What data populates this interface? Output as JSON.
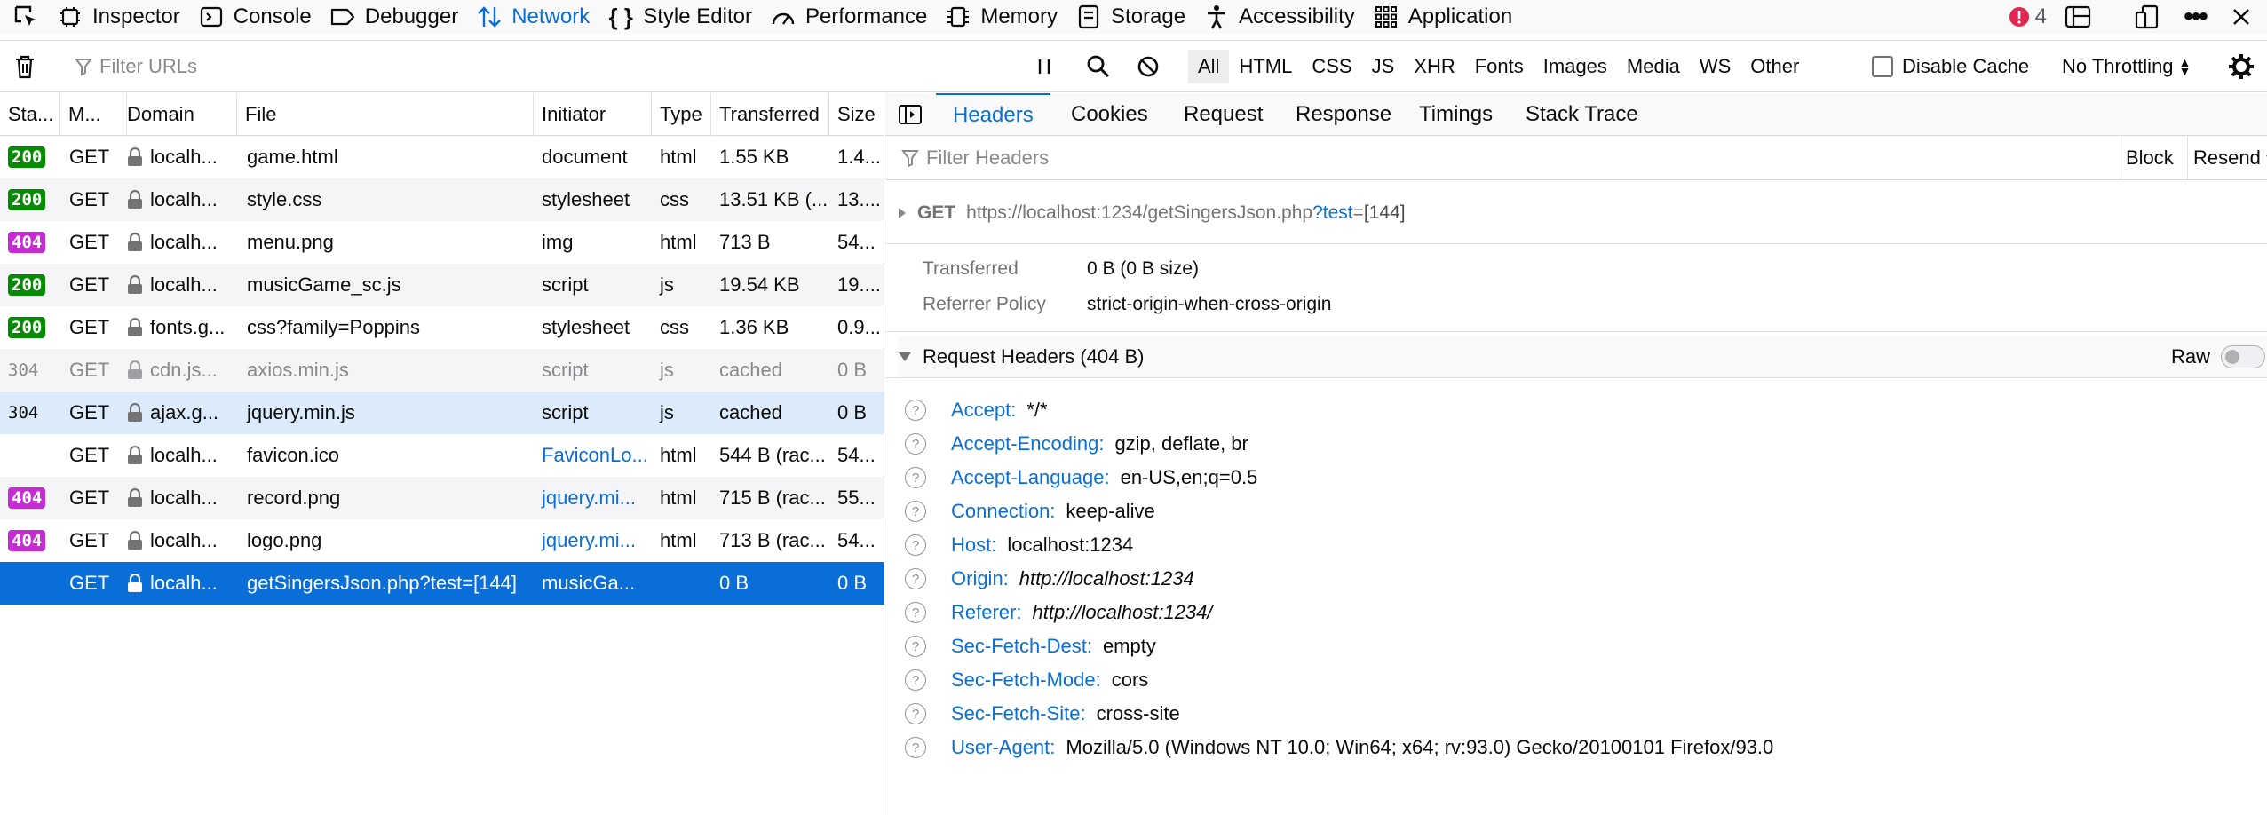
{
  "toolbar": {
    "tabs": [
      {
        "label": "Inspector",
        "icon": "inspector-icon"
      },
      {
        "label": "Console",
        "icon": "console-icon"
      },
      {
        "label": "Debugger",
        "icon": "debugger-icon"
      },
      {
        "label": "Network",
        "icon": "network-icon",
        "active": true
      },
      {
        "label": "Style Editor",
        "icon": "style-editor-icon"
      },
      {
        "label": "Performance",
        "icon": "performance-icon"
      },
      {
        "label": "Memory",
        "icon": "memory-icon"
      },
      {
        "label": "Storage",
        "icon": "storage-icon"
      },
      {
        "label": "Accessibility",
        "icon": "accessibility-icon"
      },
      {
        "label": "Application",
        "icon": "application-icon"
      }
    ],
    "error_count": "4"
  },
  "filterbar": {
    "filter_placeholder": "Filter URLs",
    "types": [
      "All",
      "HTML",
      "CSS",
      "JS",
      "XHR",
      "Fonts",
      "Images",
      "Media",
      "WS",
      "Other"
    ],
    "selected_type": "All",
    "disable_cache_label": "Disable Cache",
    "throttling": "No Throttling"
  },
  "table": {
    "columns": [
      "Sta...",
      "M...",
      "Domain",
      "File",
      "Initiator",
      "Type",
      "Transferred",
      "Size"
    ],
    "rows": [
      {
        "status": "200",
        "method": "GET",
        "domain": "localh...",
        "file": "game.html",
        "initiator": "document",
        "type": "html",
        "transferred": "1.55 KB",
        "size": "1.4..."
      },
      {
        "status": "200",
        "method": "GET",
        "domain": "localh...",
        "file": "style.css",
        "initiator": "stylesheet",
        "type": "css",
        "transferred": "13.51 KB (...",
        "size": "13...."
      },
      {
        "status": "404",
        "method": "GET",
        "domain": "localh...",
        "file": "menu.png",
        "initiator": "img",
        "type": "html",
        "transferred": "713 B",
        "size": "54..."
      },
      {
        "status": "200",
        "method": "GET",
        "domain": "localh...",
        "file": "musicGame_sc.js",
        "initiator": "script",
        "type": "js",
        "transferred": "19.54 KB",
        "size": "19...."
      },
      {
        "status": "200",
        "method": "GET",
        "domain": "fonts.g...",
        "file": "css?family=Poppins",
        "initiator": "stylesheet",
        "type": "css",
        "transferred": "1.36 KB",
        "size": "0.9..."
      },
      {
        "status": "304",
        "method": "GET",
        "domain": "cdn.js...",
        "file": "axios.min.js",
        "initiator": "script",
        "type": "js",
        "transferred": "cached",
        "size": "0 B"
      },
      {
        "status": "304",
        "method": "GET",
        "domain": "ajax.g...",
        "file": "jquery.min.js",
        "initiator": "script",
        "type": "js",
        "transferred": "cached",
        "size": "0 B"
      },
      {
        "status": "",
        "method": "GET",
        "domain": "localh...",
        "file": "favicon.ico",
        "initiator": "FaviconLo...",
        "type": "html",
        "transferred": "544 B (rac...",
        "size": "54..."
      },
      {
        "status": "404",
        "method": "GET",
        "domain": "localh...",
        "file": "record.png",
        "initiator": "jquery.mi...",
        "type": "html",
        "transferred": "715 B (rac...",
        "size": "55..."
      },
      {
        "status": "404",
        "method": "GET",
        "domain": "localh...",
        "file": "logo.png",
        "initiator": "jquery.mi...",
        "type": "html",
        "transferred": "713 B (rac...",
        "size": "54..."
      },
      {
        "status": "",
        "method": "GET",
        "domain": "localh...",
        "file": "getSingersJson.php?test=[144]",
        "initiator": "musicGa...",
        "type": "",
        "transferred": "0 B",
        "size": "0 B"
      }
    ]
  },
  "details": {
    "tabs": [
      "Headers",
      "Cookies",
      "Request",
      "Response",
      "Timings",
      "Stack Trace"
    ],
    "active_tab": "Headers",
    "filter_placeholder": "Filter Headers",
    "block_label": "Block",
    "resend_label": "Resend",
    "request": {
      "method": "GET",
      "url_base": "https://localhost:1234/getSingersJson.php",
      "url_q": "?",
      "url_param": "test",
      "url_eq": "=",
      "url_value": "[144]"
    },
    "summary": [
      {
        "label": "Transferred",
        "value": "0 B (0 B size)"
      },
      {
        "label": "Referrer Policy",
        "value": "strict-origin-when-cross-origin"
      }
    ],
    "request_headers_title": "Request Headers (404 B)",
    "raw_label": "Raw",
    "headers": [
      {
        "name": "Accept:",
        "value": "*/*"
      },
      {
        "name": "Accept-Encoding:",
        "value": "gzip, deflate, br"
      },
      {
        "name": "Accept-Language:",
        "value": "en-US,en;q=0.5"
      },
      {
        "name": "Connection:",
        "value": "keep-alive"
      },
      {
        "name": "Host:",
        "value": "localhost:1234"
      },
      {
        "name": "Origin:",
        "value": "http://localhost:1234"
      },
      {
        "name": "Referer:",
        "value": "http://localhost:1234/"
      },
      {
        "name": "Sec-Fetch-Dest:",
        "value": "empty"
      },
      {
        "name": "Sec-Fetch-Mode:",
        "value": "cors"
      },
      {
        "name": "Sec-Fetch-Site:",
        "value": "cross-site"
      },
      {
        "name": "User-Agent:",
        "value": "Mozilla/5.0 (Windows NT 10.0; Win64; x64; rv:93.0) Gecko/20100101 Firefox/93.0"
      }
    ]
  },
  "colors": {
    "accent": "#0a6ed8",
    "status_ok": "#058b00",
    "status_404": "#c42bd3",
    "error": "#e22850"
  }
}
